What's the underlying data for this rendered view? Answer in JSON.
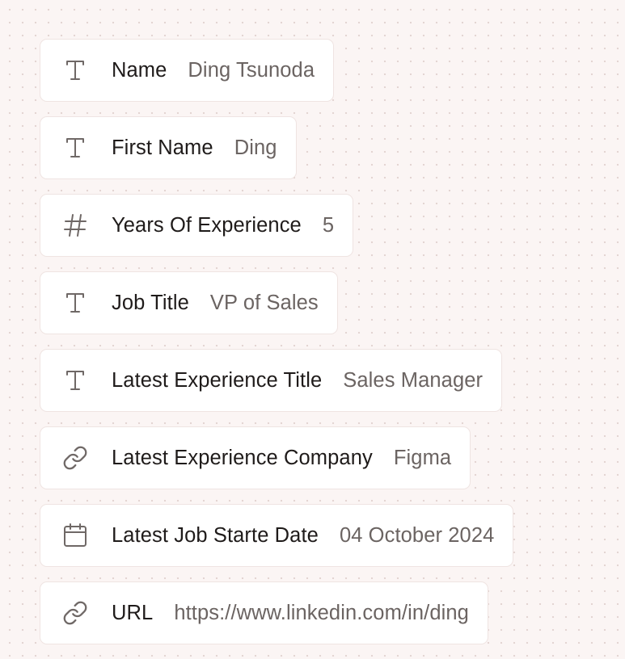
{
  "fields": [
    {
      "icon": "text-type-icon",
      "label": "Name",
      "value": "Ding Tsunoda"
    },
    {
      "icon": "text-type-icon",
      "label": "First Name",
      "value": "Ding"
    },
    {
      "icon": "number-type-icon",
      "label": "Years Of Experience",
      "value": "5"
    },
    {
      "icon": "text-type-icon",
      "label": "Job Title",
      "value": "VP of Sales"
    },
    {
      "icon": "text-type-icon",
      "label": "Latest Experience Title",
      "value": "Sales Manager"
    },
    {
      "icon": "link-type-icon",
      "label": "Latest Experience Company",
      "value": "Figma"
    },
    {
      "icon": "calendar-type-icon",
      "label": "Latest Job Starte Date",
      "value": "04 October 2024"
    },
    {
      "icon": "link-type-icon",
      "label": "URL",
      "value": "https://www.linkedin.com/in/ding"
    }
  ],
  "colors": {
    "background": "#fbf5f4",
    "card": "#ffffff",
    "card_border": "#efe4e2",
    "label": "#1f1b1a",
    "value": "#6b6462",
    "icon": "#6f6866"
  }
}
